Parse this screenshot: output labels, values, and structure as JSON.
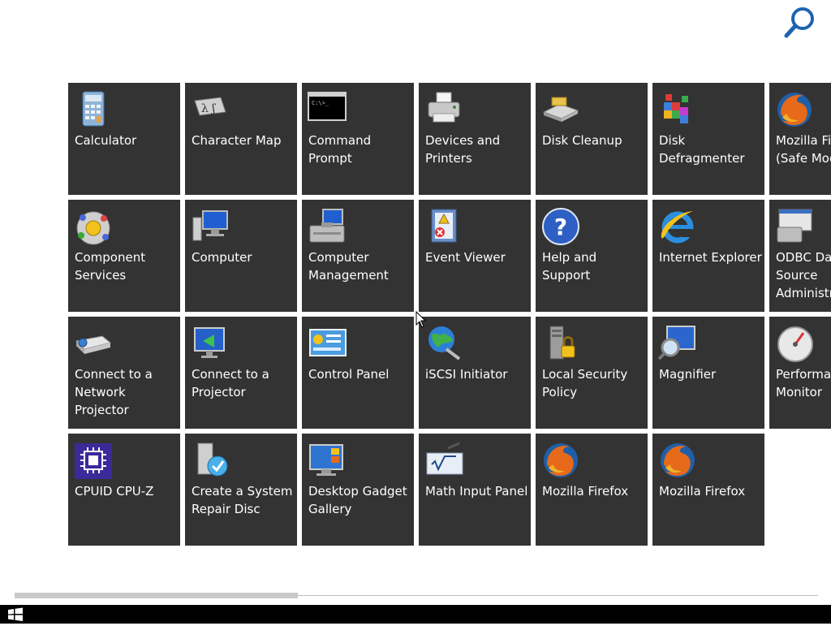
{
  "apps": [
    {
      "name": "tile-calculator",
      "label": "Calculator",
      "icon": "calculator-icon"
    },
    {
      "name": "tile-character-map",
      "label": "Character Map",
      "icon": "character-map-icon"
    },
    {
      "name": "tile-command-prompt",
      "label": "Command\nPrompt",
      "icon": "command-prompt-icon"
    },
    {
      "name": "tile-devices-and-printers",
      "label": "Devices and\nPrinters",
      "icon": "printer-icon"
    },
    {
      "name": "tile-disk-cleanup",
      "label": "Disk Cleanup",
      "icon": "disk-cleanup-icon"
    },
    {
      "name": "tile-disk-defragmenter",
      "label": "Disk\nDefragmenter",
      "icon": "disk-defragmenter-icon"
    },
    {
      "name": "tile-mozilla-firefox-safe-mode",
      "label": "Mozilla Fi\n(Safe Mod",
      "icon": "firefox-icon"
    },
    {
      "name": "tile-component-services",
      "label": "Component\nServices",
      "icon": "component-services-icon"
    },
    {
      "name": "tile-computer",
      "label": "Computer",
      "icon": "computer-icon"
    },
    {
      "name": "tile-computer-management",
      "label": "Computer\nManagement",
      "icon": "computer-management-icon"
    },
    {
      "name": "tile-event-viewer",
      "label": "Event Viewer",
      "icon": "event-viewer-icon"
    },
    {
      "name": "tile-help-and-support",
      "label": "Help and\nSupport",
      "icon": "help-icon"
    },
    {
      "name": "tile-internet-explorer",
      "label": "Internet Explorer",
      "icon": "internet-explorer-icon"
    },
    {
      "name": "tile-odbc-data-source",
      "label": "ODBC Dat\nSource\nAdministr",
      "icon": "odbc-icon"
    },
    {
      "name": "tile-connect-network-projector",
      "label": "Connect to a\nNetwork\nProjector",
      "icon": "network-projector-icon"
    },
    {
      "name": "tile-connect-projector",
      "label": "Connect to a\nProjector",
      "icon": "projector-icon"
    },
    {
      "name": "tile-control-panel",
      "label": "Control Panel",
      "icon": "control-panel-icon"
    },
    {
      "name": "tile-iscsi-initiator",
      "label": "iSCSI Initiator",
      "icon": "iscsi-icon"
    },
    {
      "name": "tile-local-security-policy",
      "label": "Local Security\nPolicy",
      "icon": "security-policy-icon"
    },
    {
      "name": "tile-magnifier",
      "label": "Magnifier",
      "icon": "magnifier-icon"
    },
    {
      "name": "tile-performance-monitor",
      "label": "Performan\nMonitor",
      "icon": "performance-monitor-icon"
    },
    {
      "name": "tile-cpuid-cpu-z",
      "label": "CPUID CPU-Z",
      "icon": "cpu-z-icon"
    },
    {
      "name": "tile-create-system-repair-disc",
      "label": "Create a System\nRepair Disc",
      "icon": "repair-disc-icon"
    },
    {
      "name": "tile-desktop-gadget-gallery",
      "label": "Desktop Gadget\nGallery",
      "icon": "gadget-gallery-icon"
    },
    {
      "name": "tile-math-input-panel",
      "label": "Math Input Panel",
      "icon": "math-input-icon"
    },
    {
      "name": "tile-mozilla-firefox-1",
      "label": "Mozilla Firefox",
      "icon": "firefox-icon"
    },
    {
      "name": "tile-mozilla-firefox-2",
      "label": "Mozilla Firefox",
      "icon": "firefox-icon"
    }
  ],
  "search": {
    "icon": "search-icon"
  },
  "taskbar": {
    "start_icon": "windows-logo-icon"
  }
}
